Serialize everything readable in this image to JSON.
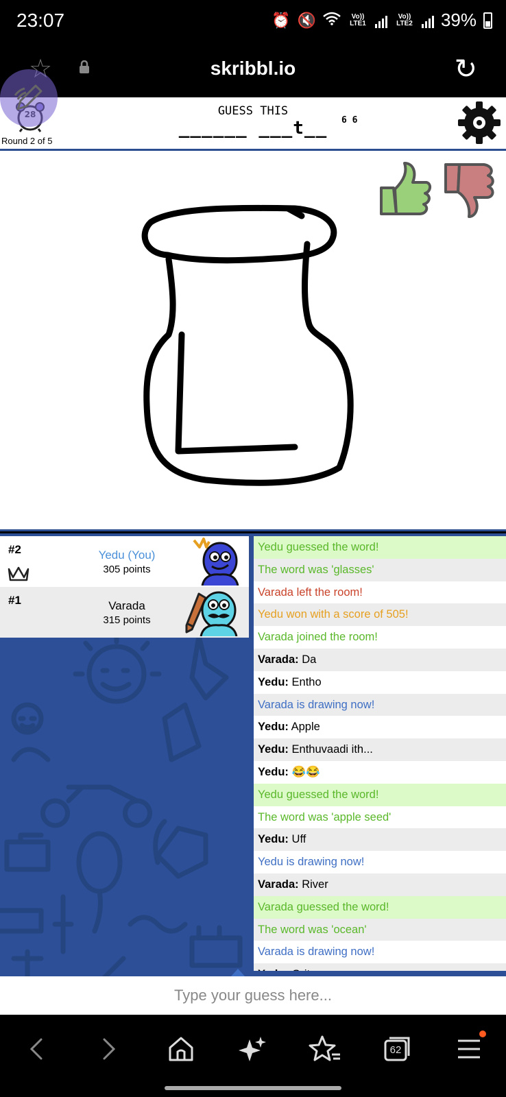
{
  "status_bar": {
    "time": "23:07",
    "sim1": "Vo)) LTE1",
    "sim2": "Vo)) LTE2",
    "battery": "39%"
  },
  "browser": {
    "title": "skribbl.io"
  },
  "game": {
    "timer": "28",
    "round": "Round 2 of 5",
    "guess_label": "GUESS THIS",
    "hint": "______ ___t__",
    "word_lengths": "6 6"
  },
  "players": [
    {
      "rank": "#2",
      "name": "Yedu (You)",
      "points": "305 points",
      "is_you": true
    },
    {
      "rank": "#1",
      "name": "Varada",
      "points": "315 points",
      "is_you": false
    }
  ],
  "chat": [
    {
      "type": "guessed",
      "text": "Yedu guessed the word!"
    },
    {
      "type": "green",
      "text": "The word was 'glasses'"
    },
    {
      "type": "red",
      "text": "Varada left the room!"
    },
    {
      "type": "orange",
      "text": "Yedu won with a score of 505!"
    },
    {
      "type": "green",
      "text": "Varada joined the room!"
    },
    {
      "type": "plain",
      "author": "Varada:",
      "text": "Da"
    },
    {
      "type": "plain",
      "author": "Yedu:",
      "text": "Entho"
    },
    {
      "type": "blue",
      "text": "Varada is drawing now!"
    },
    {
      "type": "plain",
      "author": "Yedu:",
      "text": "Apple"
    },
    {
      "type": "plain",
      "author": "Yedu:",
      "text": "Enthuvaadi ith..."
    },
    {
      "type": "plain",
      "author": "Yedu:",
      "text": "😂😂"
    },
    {
      "type": "guessed",
      "text": "Yedu guessed the word!"
    },
    {
      "type": "green",
      "text": "The word was 'apple seed'"
    },
    {
      "type": "plain",
      "author": "Yedu:",
      "text": "Uff"
    },
    {
      "type": "blue",
      "text": "Yedu is drawing now!"
    },
    {
      "type": "plain",
      "author": "Varada:",
      "text": "River"
    },
    {
      "type": "guessed",
      "text": "Varada guessed the word!"
    },
    {
      "type": "green",
      "text": "The word was 'ocean'"
    },
    {
      "type": "blue",
      "text": "Varada is drawing now!"
    },
    {
      "type": "plain",
      "author": "Yedu:",
      "text": "Grit"
    }
  ],
  "input": {
    "placeholder": "Type your guess here..."
  },
  "nav": {
    "tabs_count": "62"
  },
  "colors": {
    "accent_blue": "#2d4f98",
    "guess_green": "#5ab82a",
    "leave_red": "#c9432b",
    "win_orange": "#e6a021",
    "draw_blue": "#3f6fc4"
  }
}
